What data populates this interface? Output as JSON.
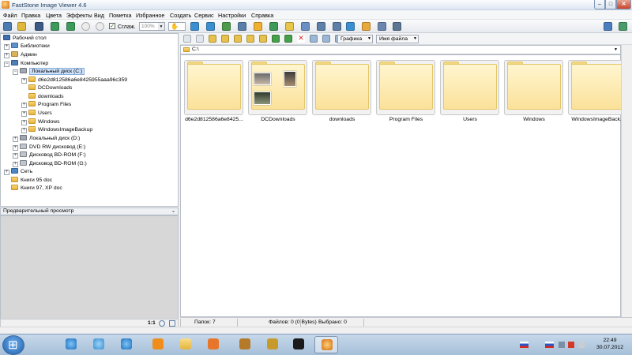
{
  "window": {
    "title": "FastStone Image Viewer 4.6",
    "min": "–",
    "max": "□",
    "close": "✕"
  },
  "menu": [
    "Файл",
    "Правка",
    "Цвета",
    "Эффекты",
    "Вид",
    "Пометка",
    "Избранное",
    "Создать",
    "Сервис",
    "Настройки",
    "Справка"
  ],
  "toolbar": {
    "smooth_label": "Сглаж.",
    "smooth_checked": "✓",
    "zoom_value": "100%",
    "hand_icon": "✋"
  },
  "tree": [
    {
      "label": "Рабочий стол"
    },
    {
      "label": "Библиотеки"
    },
    {
      "label": "Админ"
    },
    {
      "label": "Компьютер"
    },
    {
      "label": "Локальный диск (C:)"
    },
    {
      "label": "d6e2d812586a6e8425955aaa96c359"
    },
    {
      "label": "DCDownloads"
    },
    {
      "label": "downloads"
    },
    {
      "label": "Program Files"
    },
    {
      "label": "Users"
    },
    {
      "label": "Windows"
    },
    {
      "label": "WindowsImageBackup"
    },
    {
      "label": "Локальный диск (D:)"
    },
    {
      "label": "DVD RW дисковод (E:)"
    },
    {
      "label": "Дисковод BD-ROM (F:)"
    },
    {
      "label": "Дисковод BD-ROM (G:)"
    },
    {
      "label": "Сеть"
    },
    {
      "label": "Книги 95 doc"
    },
    {
      "label": "Книги 97, XP doc"
    }
  ],
  "preview": {
    "title": "Предварительный просмотр",
    "chevron": "⌄"
  },
  "left_status": {
    "ratio": "1:1"
  },
  "browser": {
    "filter": "Графика",
    "sort": "Имя файла",
    "path": "C:\\",
    "arrow": "▼"
  },
  "thumbnails": [
    {
      "label": "d6e2d812586a6e8425..."
    },
    {
      "label": "DCDownloads"
    },
    {
      "label": "downloads"
    },
    {
      "label": "Program Files"
    },
    {
      "label": "Users"
    },
    {
      "label": "Windows"
    },
    {
      "label": "WindowsImageBack..."
    }
  ],
  "status": {
    "folders": "Папок: 7",
    "files": "Файлов: 0 (0 Bytes)",
    "selected": "Выбрано: 0"
  },
  "taskbar": {
    "time": "22:49",
    "date": "30.07.2012"
  }
}
